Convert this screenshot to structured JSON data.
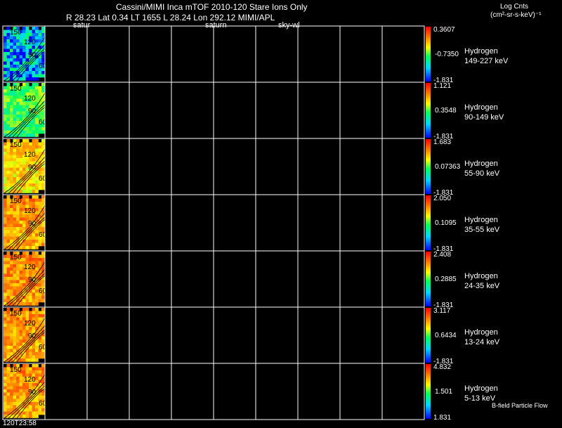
{
  "header": {
    "line1": "Cassini/MIMI Inca mTOF  2010-120   Stare   Ions Only",
    "line2": "R       28.23 Lat 0.34 LT 1655 L        28.24 Lon        292.12  MIMI/APL",
    "sub_labels": [
      "satur",
      "saturn",
      "sky-wl"
    ]
  },
  "units": {
    "line1": "Log Cnts",
    "line2": "(cm²-sr-s-keV)⁻¹"
  },
  "time_label": "120T23:58",
  "footer_label": "B-field Particle Flow",
  "colors": {
    "background": "#000000",
    "grid": "#ffffff",
    "contour": "#000000"
  },
  "chart_data": {
    "type": "heatmap",
    "columns": 10,
    "contour_labels": [
      "150",
      "120",
      "90",
      "60"
    ],
    "colorbar_scale": "rainbow (blue = low, red = high)",
    "panels": [
      {
        "species": "Hydrogen",
        "energy": "149-227 keV",
        "cbar_max": "0.3607",
        "cbar_mid": "-0.7350",
        "cbar_min": "-1.831",
        "level": 0.22
      },
      {
        "species": "Hydrogen",
        "energy": "90-149 keV",
        "cbar_max": "1.121",
        "cbar_mid": "0.3548",
        "cbar_min": "-1.831",
        "level": 0.5
      },
      {
        "species": "Hydrogen",
        "energy": "55-90 keV",
        "cbar_max": "1.683",
        "cbar_mid": "0.07363",
        "cbar_min": "-1.831",
        "level": 0.7
      },
      {
        "species": "Hydrogen",
        "energy": "35-55 keV",
        "cbar_max": "2.050",
        "cbar_mid": "0.1095",
        "cbar_min": "-1.831",
        "level": 0.78
      },
      {
        "species": "Hydrogen",
        "energy": "24-35 keV",
        "cbar_max": "2.408",
        "cbar_mid": "0.2885",
        "cbar_min": "-1.831",
        "level": 0.8
      },
      {
        "species": "Hydrogen",
        "energy": "13-24 keV",
        "cbar_max": "3.117",
        "cbar_mid": "0.6434",
        "cbar_min": "-1.831",
        "level": 0.78
      },
      {
        "species": "Hydrogen",
        "energy": "5-13 keV",
        "cbar_max": "4.832",
        "cbar_mid": "1.501",
        "cbar_min": "1.831",
        "level": 0.78
      }
    ]
  }
}
